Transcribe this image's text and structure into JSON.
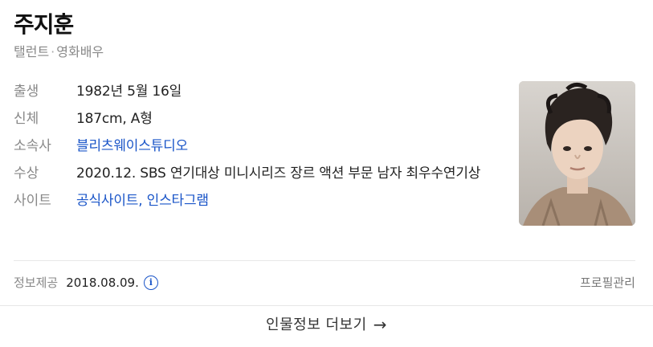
{
  "profile": {
    "name": "주지훈",
    "categories": [
      "탤런트",
      "영화배우"
    ],
    "category_separator": "·"
  },
  "info": {
    "birth": {
      "label": "출생",
      "value": "1982년 5월 16일"
    },
    "body": {
      "label": "신체",
      "value": "187cm, A형"
    },
    "agency": {
      "label": "소속사",
      "value": "블리츠웨이스튜디오"
    },
    "award": {
      "label": "수상",
      "value": "2020.12. SBS 연기대상 미니시리즈 장르 액션 부문 남자 최우수연기상"
    },
    "site": {
      "label": "사이트",
      "links": [
        "공식사이트",
        "인스타그램"
      ],
      "separator": ","
    }
  },
  "footer": {
    "source_label": "정보제공",
    "source_date": "2018.08.09.",
    "info_icon_glyph": "i",
    "manage_label": "프로필관리"
  },
  "more": {
    "label": "인물정보 더보기",
    "arrow": "→"
  },
  "colors": {
    "link": "#1a55c8",
    "label": "#888888",
    "divider": "#e7e7e7"
  },
  "icons": {
    "info": "info-circle-icon",
    "arrow": "arrow-right-icon"
  }
}
